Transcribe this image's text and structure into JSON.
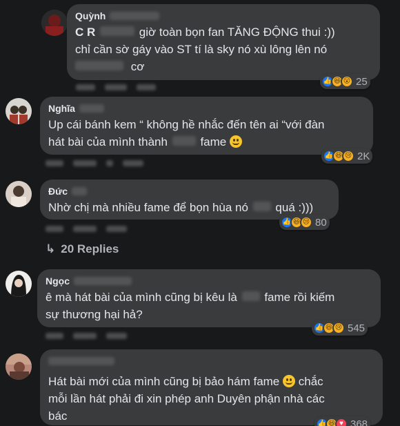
{
  "comments": [
    {
      "name": "Quỳnh",
      "lines": [
        "C R",
        "giờ toàn bọn fan TĂNG ĐỘNG thui :))",
        "chỉ cần sờ gáy vào ST tí là sky nó xù lông lên nó",
        "cơ"
      ],
      "reaction_count": "25",
      "reaction_icons": [
        "like-icon",
        "haha-icon",
        "wow-icon"
      ]
    },
    {
      "name": "Nghĩa",
      "lines": [
        "Up cái bánh kem “ không hề nhắc đến tên ai “với đàn",
        "hát bài của mình thành",
        "fame"
      ],
      "reaction_count": "2K",
      "reaction_icons": [
        "like-icon",
        "haha-icon",
        "sad-icon"
      ]
    },
    {
      "name": "Đức",
      "lines": [
        "Nhờ chị mà nhiều fame để bọn hùa nó",
        "quá :)))"
      ],
      "reaction_count": "80",
      "reaction_icons": [
        "like-icon",
        "haha-icon",
        "sad-icon"
      ]
    },
    {
      "name": "Ngọc",
      "lines": [
        "ê mà hát bài của mình cũng bị kêu là",
        "fame rồi kiếm",
        "sự thương hại hả?"
      ],
      "reaction_count": "545",
      "reaction_icons": [
        "like-icon",
        "haha-icon",
        "sad-icon"
      ]
    },
    {
      "name": "",
      "lines": [
        "Hát bài mới của mình cũng bị bảo hám fame",
        "chắc",
        "mỗi lần hát phải đi xin phép anh Duyên phận nhà các",
        "bác"
      ],
      "reaction_count": "368",
      "reaction_icons": [
        "like-icon",
        "haha-icon",
        "love-icon"
      ]
    }
  ],
  "replies_label": "20 Replies",
  "colors": {
    "background": "#18191a",
    "bubble": "#3a3b3c",
    "text": "#e4e6eb",
    "muted": "#b0b3b8",
    "like": "#1877f2",
    "emoji": "#f7b125"
  }
}
